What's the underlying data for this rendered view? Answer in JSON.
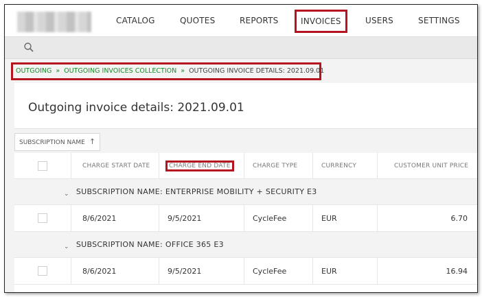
{
  "nav": {
    "items": [
      "CATALOG",
      "QUOTES",
      "REPORTS",
      "INVOICES",
      "USERS",
      "SETTINGS"
    ],
    "active": "INVOICES"
  },
  "search": {
    "icon": "search-icon"
  },
  "breadcrumb": {
    "items": [
      "OUTGOING",
      "OUTGOING INVOICES COLLECTION",
      "OUTGOING INVOICE DETAILS: 2021.09.01"
    ],
    "separator": "»"
  },
  "page": {
    "title": "Outgoing invoice details: 2021.09.01"
  },
  "grouping": {
    "label": "SUBSCRIPTION NAME",
    "sort_icon": "↑"
  },
  "table": {
    "headers": [
      "CHARGE START DATE",
      "CHARGE END DATE",
      "CHARGE TYPE",
      "CURRENCY",
      "CUSTOMER UNIT PRICE"
    ],
    "groups": [
      {
        "label": "SUBSCRIPTION NAME: ENTERPRISE MOBILITY + SECURITY E3",
        "rows": [
          {
            "start": "8/6/2021",
            "end": "9/5/2021",
            "type": "CycleFee",
            "currency": "EUR",
            "price": "6.70"
          }
        ]
      },
      {
        "label": "SUBSCRIPTION NAME: OFFICE 365 E3",
        "rows": [
          {
            "start": "8/6/2021",
            "end": "9/5/2021",
            "type": "CycleFee",
            "currency": "EUR",
            "price": "16.94"
          }
        ]
      }
    ]
  },
  "colors": {
    "highlight": "#b3141d",
    "breadcrumb_link": "#1a8a2a"
  }
}
